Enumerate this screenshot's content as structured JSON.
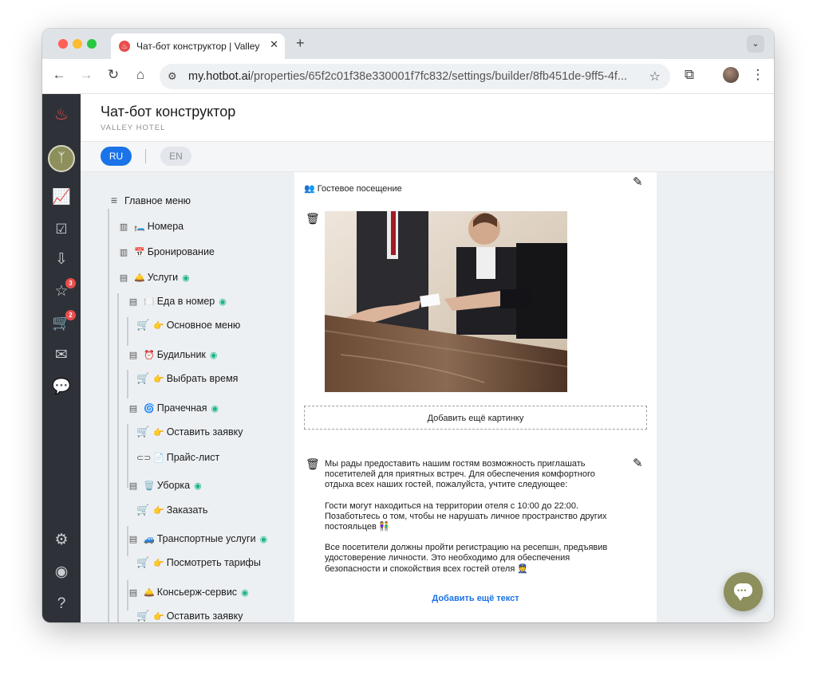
{
  "browser": {
    "tab_title": "Чат-бот конструктор | Valley",
    "tab_close": "✕",
    "new_tab": "+",
    "url_domain": "my.hotbot.ai",
    "url_path": "/properties/65f2c01f38e330001f7fc832/settings/builder/8fb451de-9ff5-4f..."
  },
  "header": {
    "title": "Чат-бот конструктор",
    "subtitle": "VALLEY HOTEL"
  },
  "languages": {
    "active": "RU",
    "inactive": "EN"
  },
  "sidebar": {
    "badges": {
      "favorites": "3",
      "cart": "2"
    }
  },
  "tree": {
    "root": "Главное меню",
    "rooms": {
      "emoji": "🛏️",
      "label": "Номера"
    },
    "booking": {
      "emoji": "📅",
      "label": "Бронирование"
    },
    "services": {
      "emoji": "🛎️",
      "label": "Услуги"
    },
    "food": {
      "emoji": "🍽️",
      "label": "Еда в номер"
    },
    "food_menu": {
      "emoji": "👉",
      "label": "Основное меню"
    },
    "alarm": {
      "emoji": "⏰",
      "label": "Будильник"
    },
    "alarm_time": {
      "emoji": "👉",
      "label": "Выбрать время"
    },
    "laundry": {
      "emoji": "🌀",
      "label": "Прачечная"
    },
    "laundry_request": {
      "emoji": "👉",
      "label": "Оставить заявку"
    },
    "laundry_prices": {
      "emoji": "📄",
      "label": "Прайс-лист"
    },
    "cleaning": {
      "emoji": "🗑️",
      "label": "Уборка"
    },
    "cleaning_order": {
      "emoji": "👉",
      "label": "Заказать"
    },
    "transport": {
      "emoji": "🚙",
      "label": "Транспортные услуги"
    },
    "transport_rates": {
      "emoji": "👉",
      "label": "Посмотреть тарифы"
    },
    "concierge": {
      "emoji": "🛎️",
      "label": "Консьерж-сервис"
    },
    "concierge_request": {
      "emoji": "👉",
      "label": "Оставить заявку"
    }
  },
  "content": {
    "title": "👥 Гостевое посещение",
    "add_image": "Добавить ещё картинку",
    "text_paragraphs": [
      "Мы рады предоставить нашим гостям возможность приглашать посетителей для приятных встреч. Для обеспечения комфортного отдыха всех наших гостей, пожалуйста, учтите следующее:",
      "Гости могут находиться на территории отеля с 10:00 до 22:00. Позаботьтесь о том, чтобы не нарушать личное пространство других постояльцев 👫",
      "Все посетители должны пройти регистрацию на ресепшн, предъявив удостоверение личности. Это необходимо для обеспечения безопасности и спокойствия всех гостей отеля 👮"
    ],
    "add_text": "Добавить ещё текст"
  },
  "colors": {
    "sidebar_bg": "#2e3238",
    "accent_blue": "#1a73e8",
    "brand_olive": "#8d8f5c",
    "badge_red": "#ea4c4c",
    "flow_green": "#1db585"
  }
}
